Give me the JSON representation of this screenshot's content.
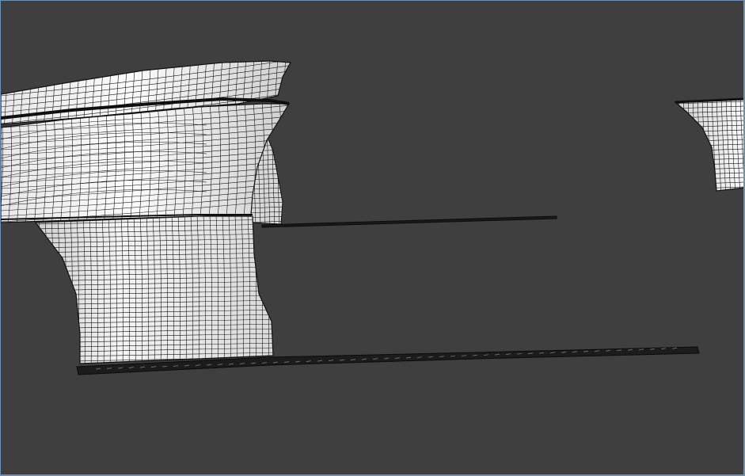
{
  "viewport": {
    "background": "#3f3f3f",
    "border_color": "#6f8fb8",
    "mesh_fill_light": "#f3f3f3",
    "mesh_fill_mid": "#d7d7d7",
    "mesh_line_color": "#111111",
    "shadow_color": "#1b1b1b"
  },
  "scene": {
    "objects": [
      {
        "kind": "wireframe-mesh",
        "name": "large-hull-fragment"
      },
      {
        "kind": "wireframe-mesh",
        "name": "right-partial-fragment"
      },
      {
        "kind": "wireframe-mesh",
        "name": "thin-strip-upper"
      },
      {
        "kind": "wireframe-mesh",
        "name": "thin-strip-lower"
      }
    ]
  }
}
